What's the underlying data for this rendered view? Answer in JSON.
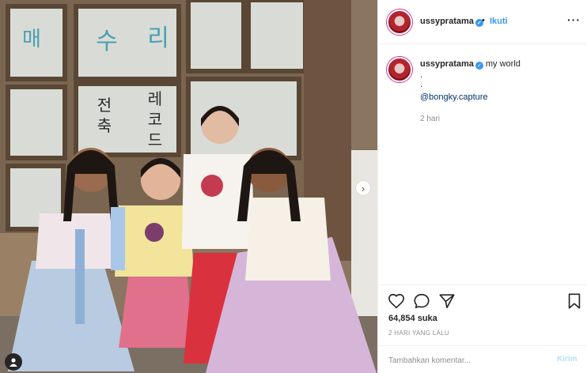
{
  "post": {
    "username": "ussypratama",
    "verified": true,
    "follow_label": "Ikuti",
    "separator": "•",
    "more_icon": "more-horizontal-icon",
    "caption": {
      "username": "ussypratama",
      "text": "my world",
      "lines": [
        ".",
        "."
      ],
      "mention": "@bongky.capture",
      "time": "2 hari"
    },
    "likes": "64,854 suka",
    "date": "2 HARI YANG LALU",
    "comment_placeholder": "Tambahkan komentar...",
    "send_label": "Kirim"
  },
  "photo": {
    "sign_text": "매 수 리",
    "sign_text_2": "전축",
    "sign_text_3": "레코드",
    "next_icon": "›"
  },
  "colors": {
    "link": "#3897f0",
    "mention": "#003569",
    "muted": "#8e8e8e",
    "border": "#efefef"
  }
}
